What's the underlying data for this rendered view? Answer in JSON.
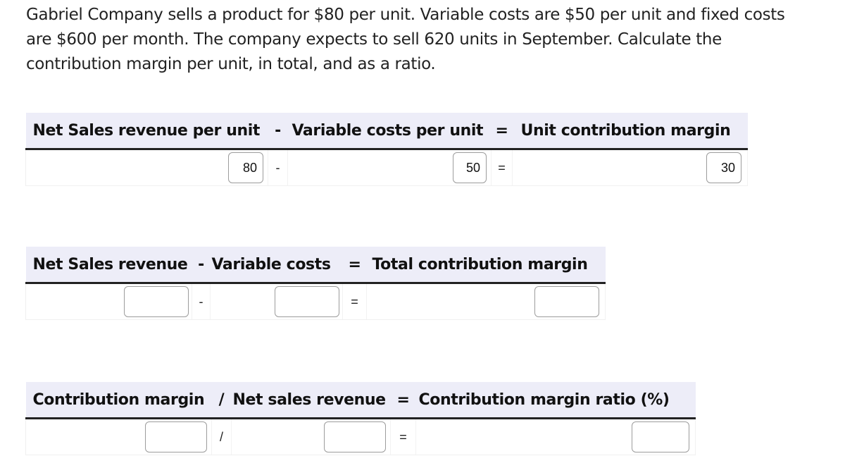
{
  "question": {
    "text": "Gabriel Company sells a product for $80 per unit. Variable costs are $50 per unit and fixed costs are $600 per month. The company expects to sell 620 units in September. Calculate the contribution margin per unit, in total, and as a ratio."
  },
  "unit_margin_table": {
    "headers": {
      "col1": "Net Sales revenue per unit",
      "op1": "-",
      "col2": "Variable costs per unit",
      "op2": "=",
      "col3": "Unit contribution margin"
    },
    "row": {
      "col1_value": "80",
      "op1": "-",
      "col2_value": "50",
      "op2": "=",
      "col3_value": "30"
    }
  },
  "total_margin_table": {
    "headers": {
      "col1": "Net Sales revenue",
      "op1": "-",
      "col2": "Variable costs",
      "op2": "=",
      "col3": "Total contribution margin"
    },
    "row": {
      "col1_value": "",
      "op1": "-",
      "col2_value": "",
      "op2": "=",
      "col3_value": ""
    }
  },
  "ratio_table": {
    "headers": {
      "col1": "Contribution margin",
      "op1": "/",
      "col2": "Net sales revenue",
      "op2": "=",
      "col3": "Contribution margin ratio (%)"
    },
    "row": {
      "col1_value": "",
      "op1": "/",
      "col2_value": "",
      "op2": "=",
      "col3_value": ""
    }
  }
}
